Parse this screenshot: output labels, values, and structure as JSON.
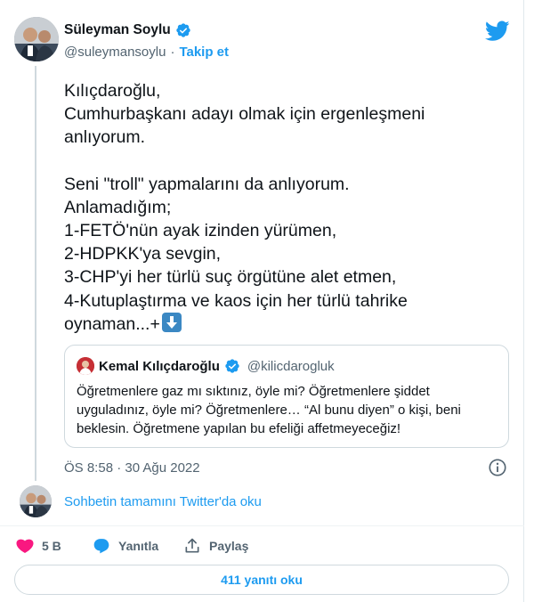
{
  "author": {
    "name": "Süleyman Soylu",
    "handle": "@suleymansoylu",
    "separator": "·",
    "follow_label": "Takip et"
  },
  "tweet": {
    "lines": [
      "Kılıçdaroğlu,",
      "Cumhurbaşkanı adayı olmak için ergenleşmeni",
      "anlıyorum.",
      "",
      "Seni \"troll\" yapmalarını da anlıyorum.",
      "Anlamadığım;",
      "1-FETÖ'nün ayak izinden yürümen,",
      "2-HDPKK'ya sevgin,",
      "3-CHP'yi her türlü suç örgütüne alet etmen,",
      "4-Kutuplaştırma ve kaos için her türlü tahrike",
      "oynaman...+"
    ],
    "emoji": "down-arrow-emoji"
  },
  "quote": {
    "name": "Kemal Kılıçdaroğlu",
    "handle": "@kilicdarogluk",
    "text": "Öğretmenlere gaz mı sıktınız, öyle mi? Öğretmenlere şiddet uyguladınız, öyle mi? Öğretmenlere… “Al bunu diyen” o kişi, beni beklesin. Öğretmene yapılan bu efeliği affetmeyeceğiz!"
  },
  "timestamp": "ÖS 8:58 · 30 Ağu 2022",
  "read_thread_label": "Sohbetin tamamını Twitter'da oku",
  "actions": {
    "like_count": "5 B",
    "reply_label": "Yanıtla",
    "share_label": "Paylaş"
  },
  "replies_button_label": "411 yanıtı oku",
  "colors": {
    "accent": "#1d9bf0",
    "like": "#f91880",
    "text": "#0f1419",
    "muted": "#536471"
  }
}
